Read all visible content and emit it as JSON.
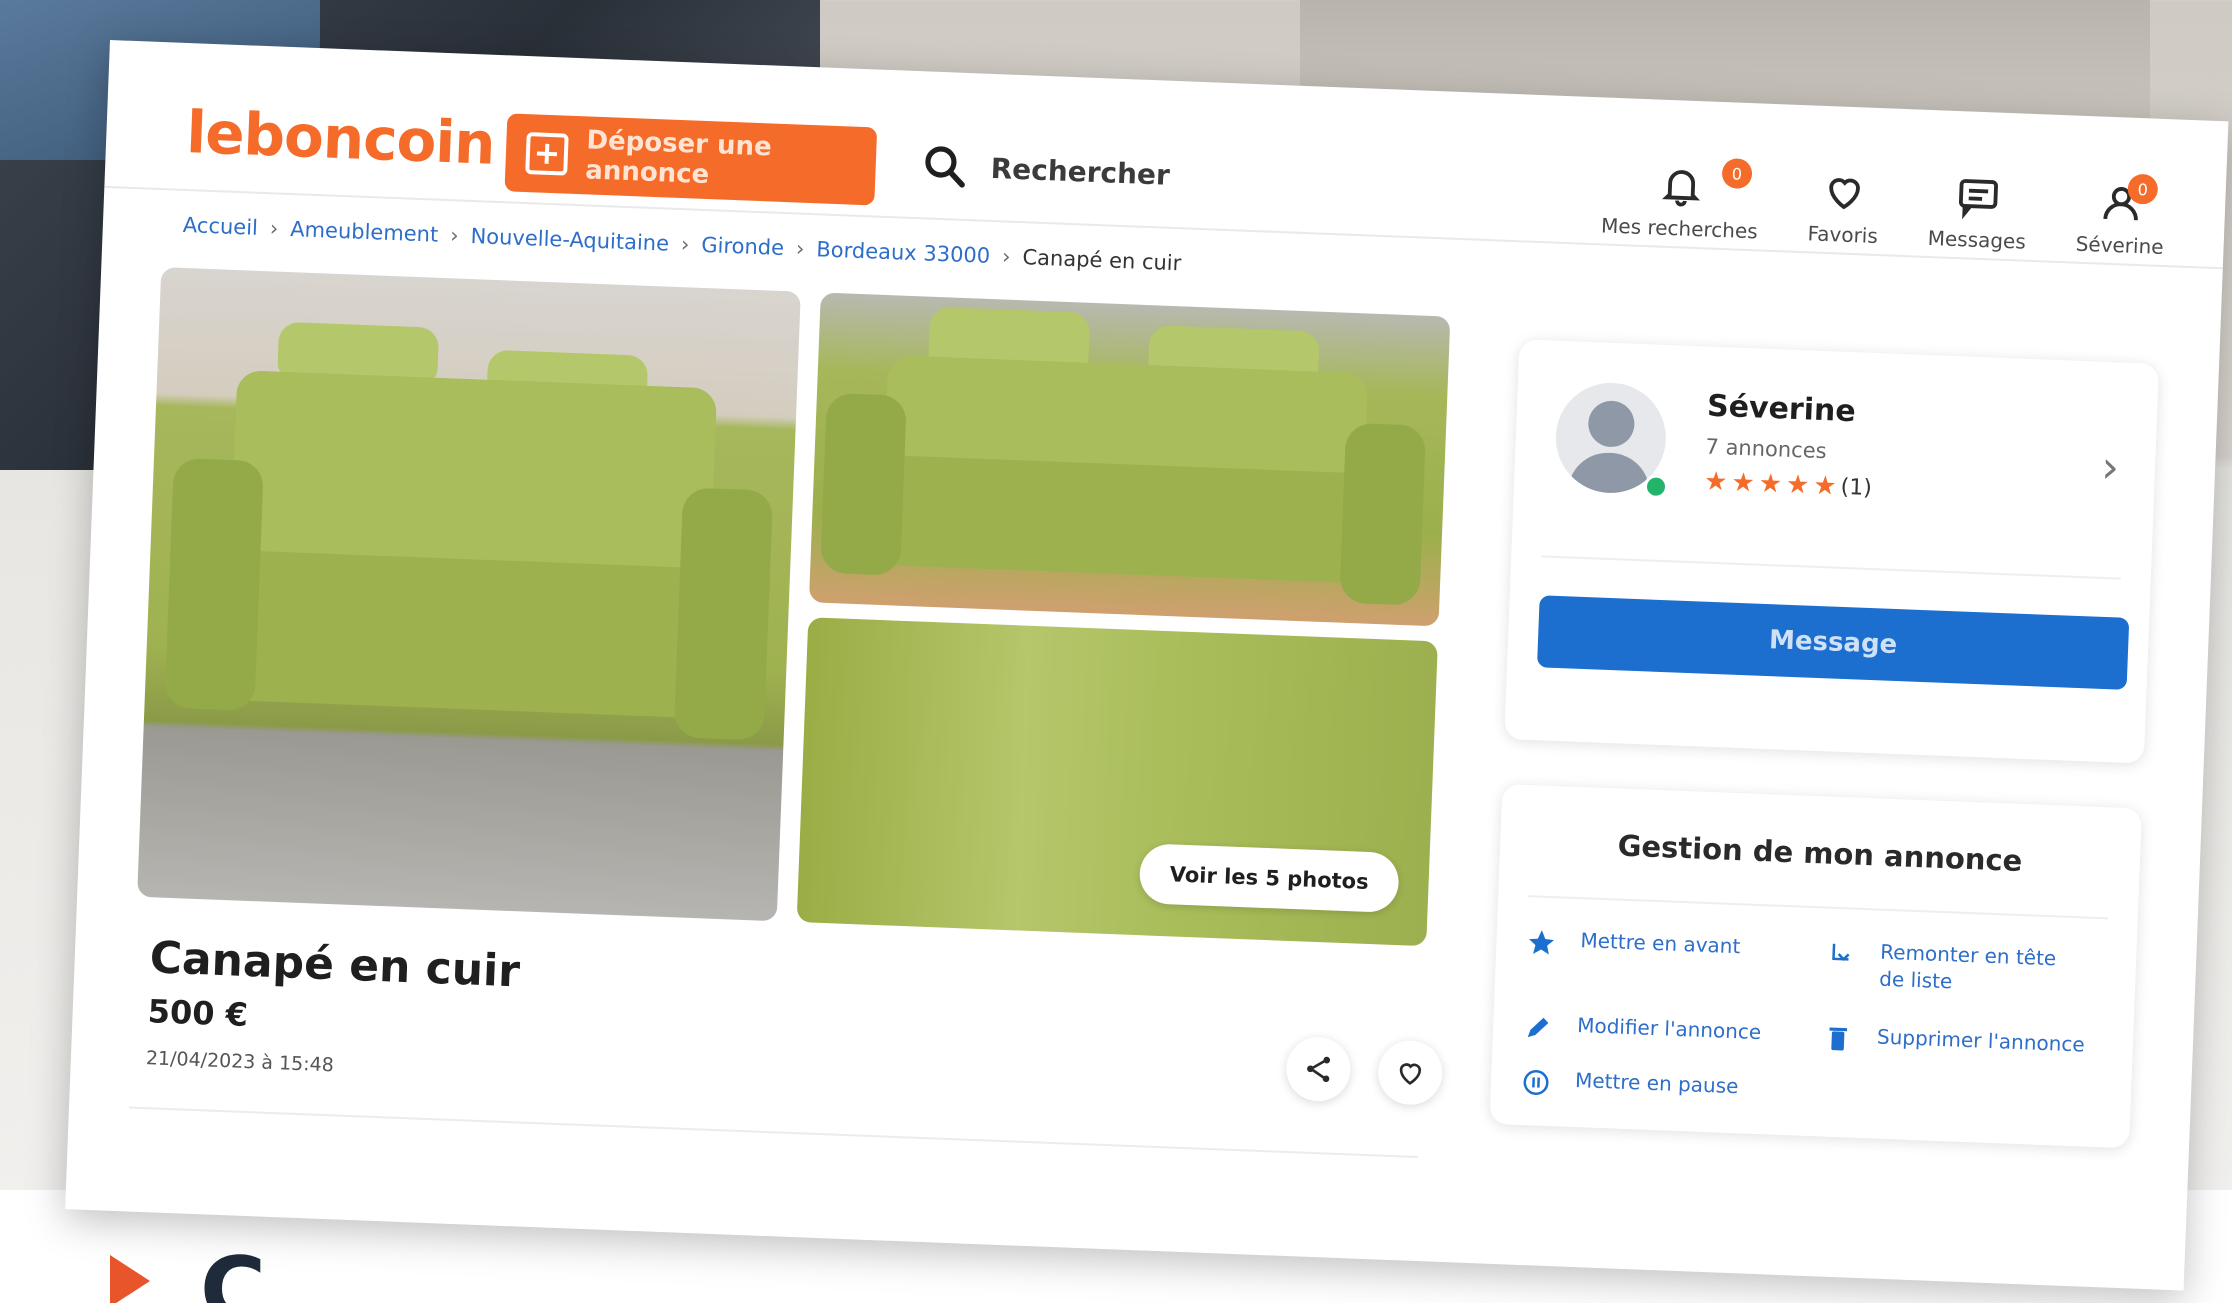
{
  "header": {
    "logo": "leboncoin",
    "deposit_label": "Déposer une annonce",
    "search_label": "Rechercher",
    "nav": [
      {
        "label": "Mes recherches",
        "icon": "bell-icon",
        "badge": "0"
      },
      {
        "label": "Favoris",
        "icon": "heart-icon"
      },
      {
        "label": "Messages",
        "icon": "message-icon"
      },
      {
        "label": "Séverine",
        "icon": "user-icon",
        "badge": "0"
      }
    ]
  },
  "breadcrumb": [
    "Accueil",
    "Ameublement",
    "Nouvelle-Aquitaine",
    "Gironde",
    "Bordeaux 33000",
    "Canapé en cuir"
  ],
  "gallery": {
    "photos_button": "Voir les 5 photos"
  },
  "ad": {
    "title": "Canapé en cuir",
    "price": "500 €",
    "date": "21/04/2023 à 15:48"
  },
  "seller": {
    "name": "Séverine",
    "ads_count": "7 annonces",
    "rating_count": "(1)",
    "message_button": "Message"
  },
  "manage": {
    "title": "Gestion de mon annonce",
    "items": [
      {
        "label": "Mettre en avant",
        "icon": "star-icon"
      },
      {
        "label": "Remonter en tête de liste",
        "icon": "up-icon"
      },
      {
        "label": "Modifier l'annonce",
        "icon": "pencil-icon"
      },
      {
        "label": "Supprimer l'annonce",
        "icon": "trash-icon"
      },
      {
        "label": "Mettre en pause",
        "icon": "pause-icon"
      }
    ]
  },
  "colors": {
    "brand": "#f56b2a",
    "primary": "#1c6fcf",
    "link": "#2e6ec9"
  }
}
